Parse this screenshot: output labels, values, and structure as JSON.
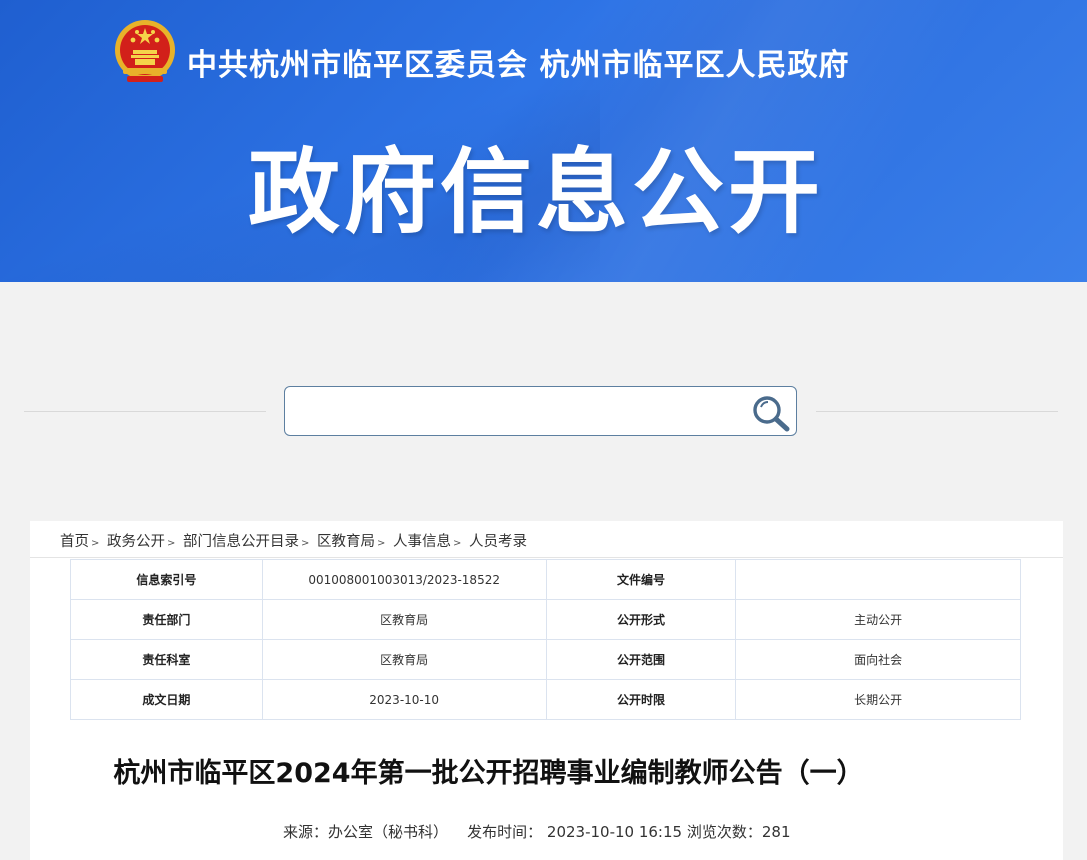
{
  "header": {
    "org_title": "中共杭州市临平区委员会  杭州市临平区人民政府",
    "big_title": "政府信息公开",
    "brand_color": "#2a6ddf"
  },
  "search": {
    "placeholder": "",
    "icon": "search-icon"
  },
  "breadcrumb": [
    "首页",
    "政务公开",
    "部门信息公开目录",
    "区教育局",
    "人事信息",
    "人员考录"
  ],
  "meta_table": {
    "rows": [
      [
        {
          "k": "信息索引号"
        },
        {
          "v": "001008001003013/2023-18522"
        },
        {
          "k": "文件编号"
        },
        {
          "v": ""
        }
      ],
      [
        {
          "k": "责任部门"
        },
        {
          "v": "区教育局"
        },
        {
          "k": "公开形式"
        },
        {
          "v": "主动公开"
        }
      ],
      [
        {
          "k": "责任科室"
        },
        {
          "v": "区教育局"
        },
        {
          "k": "公开范围"
        },
        {
          "v": "面向社会"
        }
      ],
      [
        {
          "k": "成文日期"
        },
        {
          "v": "2023-10-10"
        },
        {
          "k": "公开时限"
        },
        {
          "v": "长期公开"
        }
      ]
    ]
  },
  "article": {
    "title": "杭州市临平区2024年第一批公开招聘事业编制教师公告（一）",
    "source_label": "来源：",
    "source": "办公室（秘书科）",
    "publish_label": "发布时间：",
    "publish_time": "2023-10-10 16:15",
    "views_label": "浏览次数：",
    "views": "281"
  }
}
